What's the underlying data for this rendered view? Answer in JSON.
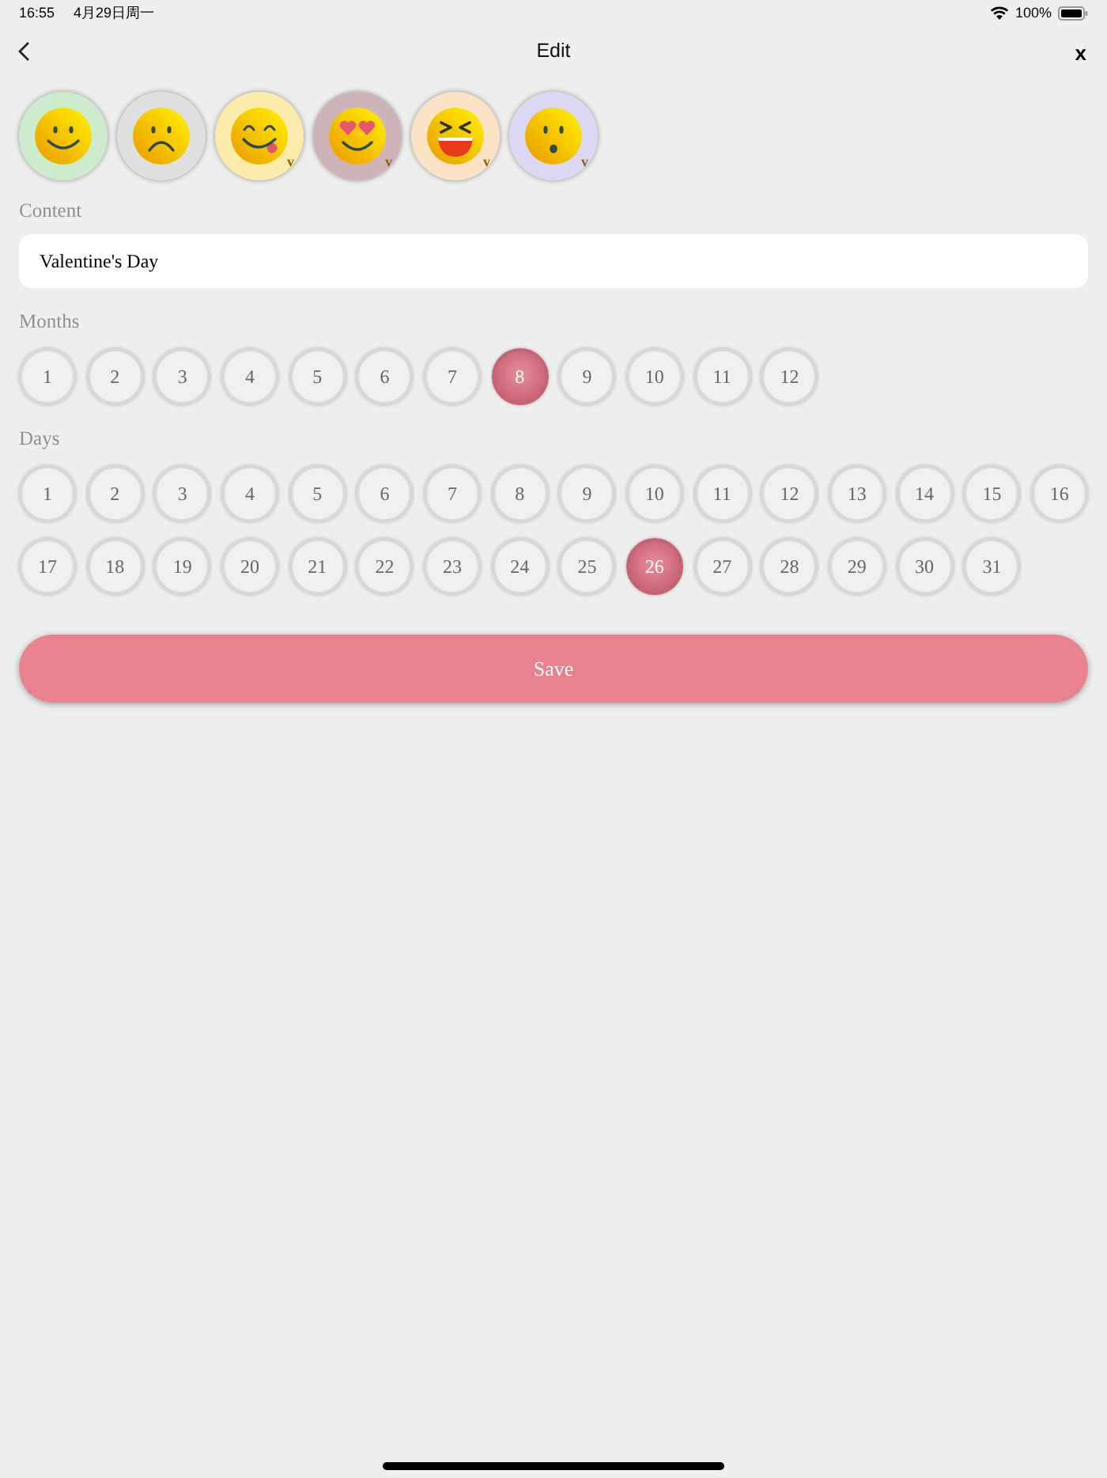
{
  "status_bar": {
    "time": "16:55",
    "date": "4月29日周一",
    "battery": "100%"
  },
  "nav": {
    "title": "Edit",
    "close": "x"
  },
  "moods": [
    {
      "kind": "smile",
      "color": "#cdeccd"
    },
    {
      "kind": "frown",
      "color": "#e0e0e0"
    },
    {
      "kind": "yum",
      "color": "#fcebaa",
      "badge": "v"
    },
    {
      "kind": "hearts",
      "color": "#d0b4b9",
      "badge": "v"
    },
    {
      "kind": "laugh",
      "color": "#fde3c5",
      "badge": "v"
    },
    {
      "kind": "surprised",
      "color": "#dcd7f5",
      "badge": "v"
    }
  ],
  "content": {
    "label": "Content",
    "value": "Valentine's Day"
  },
  "months": {
    "label": "Months",
    "items": [
      {
        "label": "1",
        "selected": false
      },
      {
        "label": "2",
        "selected": false
      },
      {
        "label": "3",
        "selected": false
      },
      {
        "label": "4",
        "selected": false
      },
      {
        "label": "5",
        "selected": false
      },
      {
        "label": "6",
        "selected": false
      },
      {
        "label": "7",
        "selected": false
      },
      {
        "label": "8",
        "selected": true
      },
      {
        "label": "9",
        "selected": false
      },
      {
        "label": "10",
        "selected": false
      },
      {
        "label": "11",
        "selected": false
      },
      {
        "label": "12",
        "selected": false
      }
    ]
  },
  "days": {
    "label": "Days",
    "items": [
      {
        "label": "1",
        "selected": false
      },
      {
        "label": "2",
        "selected": false
      },
      {
        "label": "3",
        "selected": false
      },
      {
        "label": "4",
        "selected": false
      },
      {
        "label": "5",
        "selected": false
      },
      {
        "label": "6",
        "selected": false
      },
      {
        "label": "7",
        "selected": false
      },
      {
        "label": "8",
        "selected": false
      },
      {
        "label": "9",
        "selected": false
      },
      {
        "label": "10",
        "selected": false
      },
      {
        "label": "11",
        "selected": false
      },
      {
        "label": "12",
        "selected": false
      },
      {
        "label": "13",
        "selected": false
      },
      {
        "label": "14",
        "selected": false
      },
      {
        "label": "15",
        "selected": false
      },
      {
        "label": "16",
        "selected": false
      },
      {
        "label": "17",
        "selected": false
      },
      {
        "label": "18",
        "selected": false
      },
      {
        "label": "19",
        "selected": false
      },
      {
        "label": "20",
        "selected": false
      },
      {
        "label": "21",
        "selected": false
      },
      {
        "label": "22",
        "selected": false
      },
      {
        "label": "23",
        "selected": false
      },
      {
        "label": "24",
        "selected": false
      },
      {
        "label": "25",
        "selected": false
      },
      {
        "label": "26",
        "selected": true
      },
      {
        "label": "27",
        "selected": false
      },
      {
        "label": "28",
        "selected": false
      },
      {
        "label": "29",
        "selected": false
      },
      {
        "label": "30",
        "selected": false
      },
      {
        "label": "31",
        "selected": false
      }
    ]
  },
  "save_button": "Save"
}
